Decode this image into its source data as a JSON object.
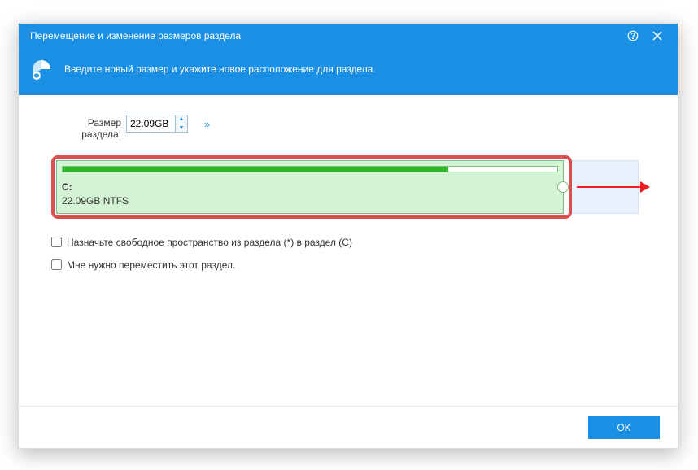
{
  "titlebar": {
    "title": "Перемещение и изменение размеров раздела"
  },
  "banner": {
    "text": "Введите новый размер и укажите новое расположение для раздела."
  },
  "size": {
    "label": "Размер раздела:",
    "value": "22.09GB"
  },
  "partition": {
    "drive": "C:",
    "detail": "22.09GB NTFS",
    "fill_percent": 78
  },
  "checkboxes": {
    "assign_free": "Назначьте свободное пространство из раздела (*) в раздел (C)",
    "need_move": "Мне нужно переместить этот раздел."
  },
  "footer": {
    "ok": "OK"
  }
}
